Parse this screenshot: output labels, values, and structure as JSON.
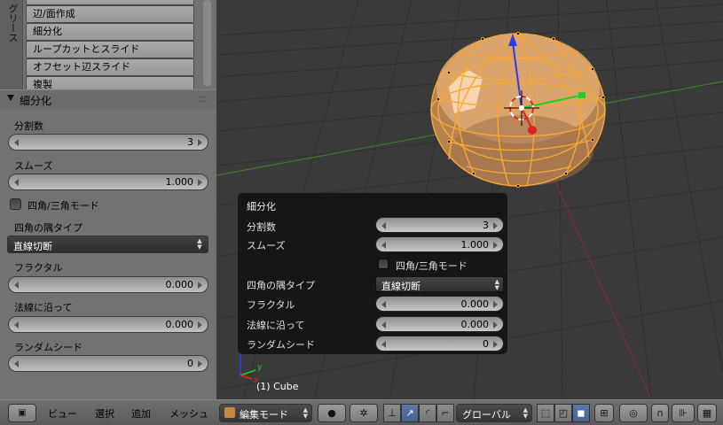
{
  "tool_shelf": {
    "tab_label": "グリース",
    "operators": [
      "",
      "辺/面作成",
      "細分化",
      "ループカットとスライド",
      "オフセット辺スライド",
      "複製"
    ]
  },
  "panel": {
    "title": "細分化",
    "cuts_label": "分割数",
    "cuts_value": "3",
    "smooth_label": "スムーズ",
    "smooth_value": "1.000",
    "quad_tri_label": "四角/三角モード",
    "corner_type_label": "四角の隅タイプ",
    "corner_type_value": "直線切断",
    "fractal_label": "フラクタル",
    "fractal_value": "0.000",
    "along_normal_label": "法線に沿って",
    "along_normal_value": "0.000",
    "seed_label": "ランダムシード",
    "seed_value": "0"
  },
  "redo_panel": {
    "title": "細分化",
    "cuts_label": "分割数",
    "cuts_value": "3",
    "smooth_label": "スムーズ",
    "smooth_value": "1.000",
    "quad_tri_label": "四角/三角モード",
    "corner_type_label": "四角の隅タイプ",
    "corner_type_value": "直線切断",
    "fractal_label": "フラクタル",
    "fractal_value": "0.000",
    "along_normal_label": "法線に沿って",
    "along_normal_value": "0.000",
    "seed_label": "ランダムシード",
    "seed_value": "0"
  },
  "viewport": {
    "object_label": "(1) Cube",
    "axis_y_label": "y",
    "axis_x_label": "x"
  },
  "header": {
    "menu_view": "ビュー",
    "menu_select": "選択",
    "menu_add": "追加",
    "menu_mesh": "メッシュ",
    "mode_value": "編集モード",
    "orientation_value": "グローバル"
  },
  "colors": {
    "selection_orange": "#f7a733",
    "axis_blue": "#2a3cf0",
    "axis_green": "#22d022",
    "axis_red": "#e12020"
  }
}
